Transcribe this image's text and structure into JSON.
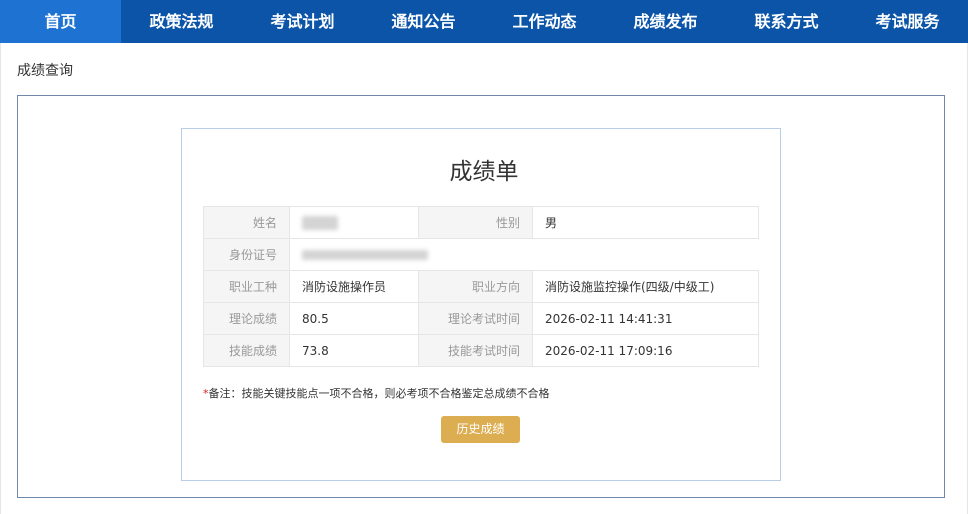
{
  "nav": {
    "items": [
      {
        "label": "首页",
        "active": true
      },
      {
        "label": "政策法规"
      },
      {
        "label": "考试计划"
      },
      {
        "label": "通知公告"
      },
      {
        "label": "工作动态"
      },
      {
        "label": "成绩发布"
      },
      {
        "label": "联系方式"
      },
      {
        "label": "考试服务"
      }
    ],
    "colors": {
      "bar": "#0b54a8",
      "active": "#1e73d2"
    }
  },
  "breadcrumb": "成绩查询",
  "report": {
    "title": "成绩单",
    "rows": {
      "name_label": "姓名",
      "gender_label": "性别",
      "gender_value": "男",
      "id_label": "身份证号",
      "occupation_label": "职业工种",
      "occupation_value": "消防设施操作员",
      "direction_label": "职业方向",
      "direction_value": "消防设施监控操作(四级/中级工)",
      "theory_label": "理论成绩",
      "theory_value": "80.5",
      "theory_time_label": "理论考试时间",
      "theory_time_value": "2026-02-11 14:41:31",
      "skill_label": "技能成绩",
      "skill_value": "73.8",
      "skill_time_label": "技能考试时间",
      "skill_time_value": "2026-02-11 17:09:16"
    },
    "note_star": "*",
    "note_text": "备注：技能关键技能点一项不合格，则必考项不合格鉴定总成绩不合格",
    "history_button": "历史成绩"
  }
}
